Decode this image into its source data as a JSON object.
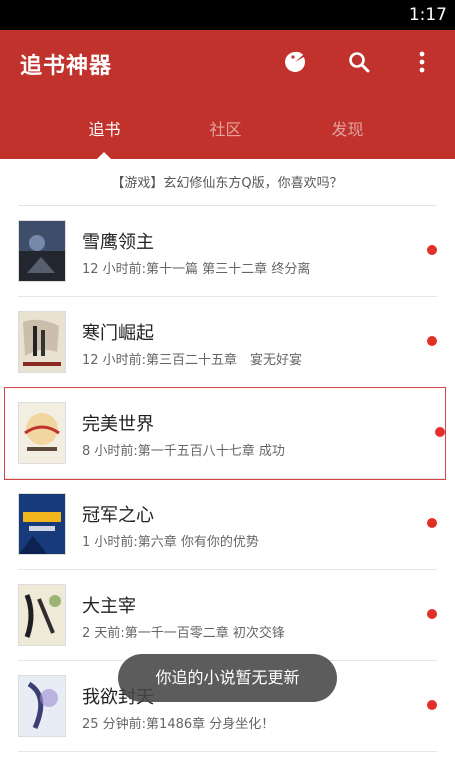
{
  "status_bar": {
    "time": "1:17"
  },
  "app_bar": {
    "title": "追书神器",
    "tabs": [
      {
        "label": "追书"
      },
      {
        "label": "社区"
      },
      {
        "label": "发现"
      }
    ]
  },
  "banner": {
    "text": "【游戏】玄幻修仙东方Q版，你喜欢吗？"
  },
  "books": [
    {
      "title": "雪鹰领主",
      "update": "12 小时前:第十一篇 第三十二章 终分离"
    },
    {
      "title": "寒门崛起",
      "update": "12 小时前:第三百二十五章　宴无好宴"
    },
    {
      "title": "完美世界",
      "update": "8 小时前:第一千五百八十七章 成功"
    },
    {
      "title": "冠军之心",
      "update": "1 小时前:第六章 你有你的优势"
    },
    {
      "title": "大主宰",
      "update": "2 天前:第一千一百零二章 初次交锋"
    },
    {
      "title": "我欲封天",
      "update": "25 分钟前:第1486章 分身坐化！"
    }
  ],
  "toast": {
    "text": "你追的小说暂无更新"
  },
  "colors": {
    "primary": "#c0322b",
    "unread_dot": "#e12f2a"
  }
}
